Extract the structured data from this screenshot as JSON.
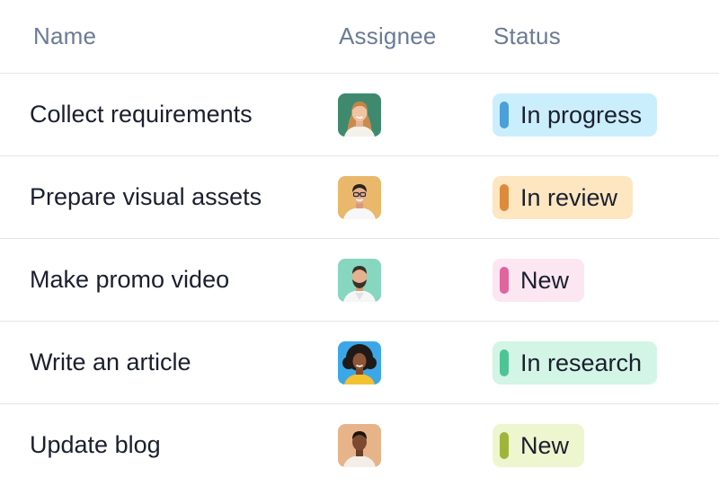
{
  "columns": {
    "name": "Name",
    "assignee": "Assignee",
    "status": "Status"
  },
  "rows": [
    {
      "name": "Collect requirements",
      "avatar_icon": "avatar-woman-blonde-icon",
      "avatar_bg": "#3f8a6e",
      "status": "In progress",
      "status_bg": "#cbeefc",
      "status_color": "#4aa0d8"
    },
    {
      "name": "Prepare visual assets",
      "avatar_icon": "avatar-man-glasses-icon",
      "avatar_bg": "#e9b86a",
      "status": "In review",
      "status_bg": "#fde6c0",
      "status_color": "#dc8a3c"
    },
    {
      "name": "Make promo video",
      "avatar_icon": "avatar-man-beard-icon",
      "avatar_bg": "#86d6c0",
      "status": "New",
      "status_bg": "#fbe6f2",
      "status_color": "#e0659c"
    },
    {
      "name": "Write an article",
      "avatar_icon": "avatar-woman-curly-icon",
      "avatar_bg": "#3ba7e8",
      "status": "In research",
      "status_bg": "#d3f5e6",
      "status_color": "#4dc495"
    },
    {
      "name": "Update blog",
      "avatar_icon": "avatar-man-icon",
      "avatar_bg": "#e7b48a",
      "status": "New",
      "status_bg": "#eef6cf",
      "status_color": "#9db63a"
    }
  ]
}
